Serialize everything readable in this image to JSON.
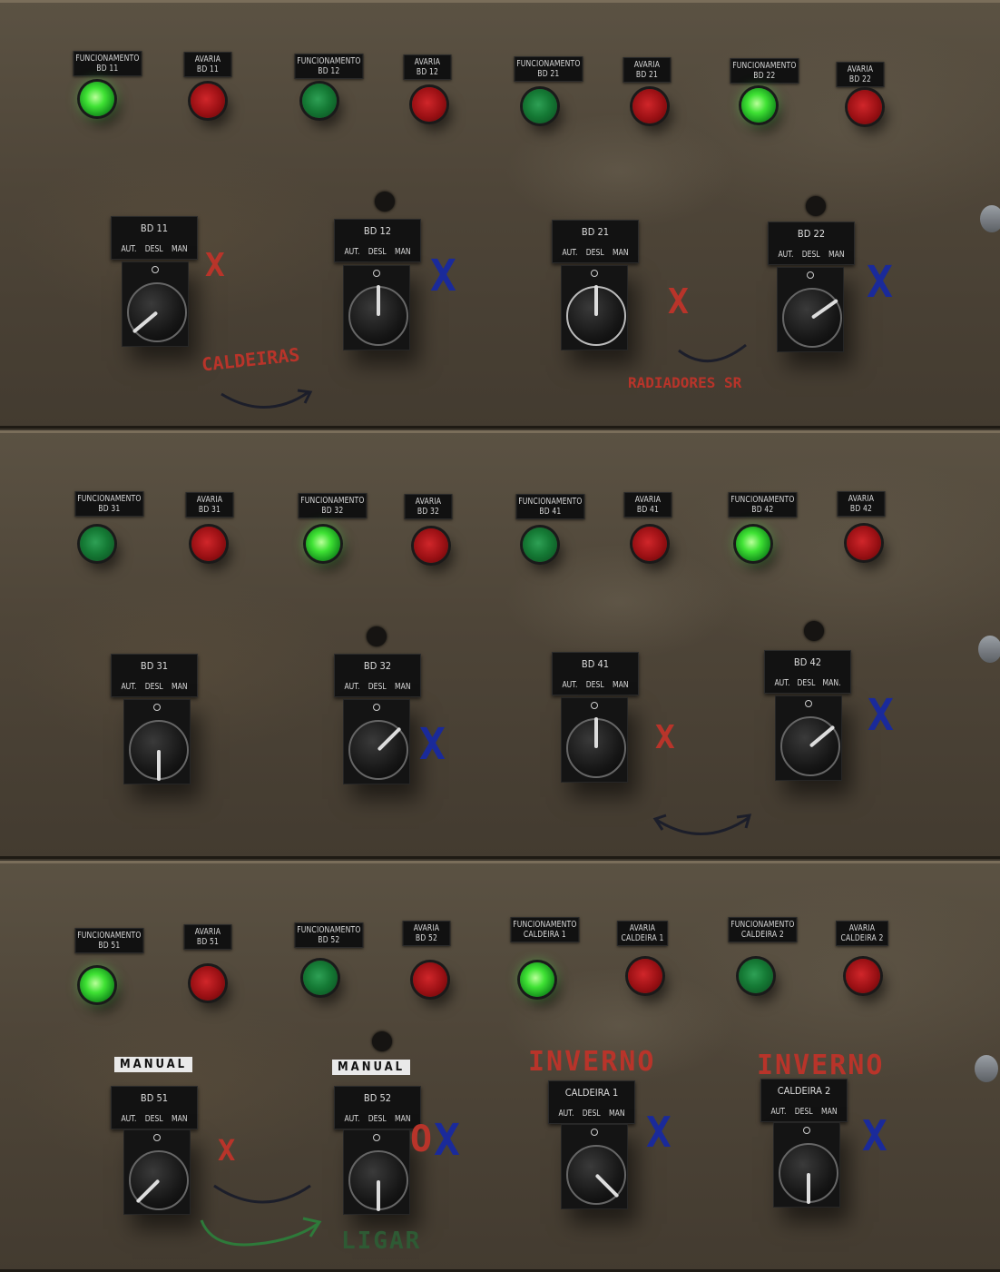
{
  "panels": [
    {
      "lamps": [
        {
          "l1": "FUNCIONAMENTO",
          "l2": "BD 11",
          "state": "g-on"
        },
        {
          "l1": "AVARIA",
          "l2": "BD 11",
          "state": "r-off"
        },
        {
          "l1": "FUNCIONAMENTO",
          "l2": "BD 12",
          "state": "g-off"
        },
        {
          "l1": "AVARIA",
          "l2": "BD 12",
          "state": "r-off"
        },
        {
          "l1": "FUNCIONAMENTO",
          "l2": "BD 21",
          "state": "g-off"
        },
        {
          "l1": "AVARIA",
          "l2": "BD 21",
          "state": "r-off"
        },
        {
          "l1": "FUNCIONAMENTO",
          "l2": "BD 22",
          "state": "g-on"
        },
        {
          "l1": "AVARIA",
          "l2": "BD 22",
          "state": "r-off"
        }
      ],
      "switches": [
        {
          "title": "BD 11",
          "aut": "AUT.",
          "desl": "DESL",
          "man": "MAN"
        },
        {
          "title": "BD 12",
          "aut": "AUT.",
          "desl": "DESL",
          "man": "MAN"
        },
        {
          "title": "BD 21",
          "aut": "AUT.",
          "desl": "DESL",
          "man": "MAN"
        },
        {
          "title": "BD 22",
          "aut": "AUT.",
          "desl": "DESL",
          "man": "MAN"
        }
      ],
      "notes": {
        "left": "CALDEIRAS",
        "right": "RADIADORES SR"
      }
    },
    {
      "lamps": [
        {
          "l1": "FUNCIONAMENTO",
          "l2": "BD 31",
          "state": "g-off"
        },
        {
          "l1": "AVARIA",
          "l2": "BD 31",
          "state": "r-off"
        },
        {
          "l1": "FUNCIONAMENTO",
          "l2": "BD 32",
          "state": "g-on"
        },
        {
          "l1": "AVARIA",
          "l2": "BD 32",
          "state": "r-off"
        },
        {
          "l1": "FUNCIONAMENTO",
          "l2": "BD 41",
          "state": "g-off"
        },
        {
          "l1": "AVARIA",
          "l2": "BD 41",
          "state": "r-off"
        },
        {
          "l1": "FUNCIONAMENTO",
          "l2": "BD 42",
          "state": "g-on"
        },
        {
          "l1": "AVARIA",
          "l2": "BD 42",
          "state": "r-off"
        }
      ],
      "switches": [
        {
          "title": "BD 31",
          "aut": "AUT.",
          "desl": "DESL",
          "man": "MAN"
        },
        {
          "title": "BD 32",
          "aut": "AUT.",
          "desl": "DESL",
          "man": "MAN"
        },
        {
          "title": "BD 41",
          "aut": "AUT.",
          "desl": "DESL",
          "man": "MAN"
        },
        {
          "title": "BD 42",
          "aut": "AUT.",
          "desl": "DESL",
          "man": "MAN."
        }
      ]
    },
    {
      "lamps": [
        {
          "l1": "FUNCIONAMENTO",
          "l2": "BD 51",
          "state": "g-on"
        },
        {
          "l1": "AVARIA",
          "l2": "BD 51",
          "state": "r-off"
        },
        {
          "l1": "FUNCIONAMENTO",
          "l2": "BD 52",
          "state": "g-off"
        },
        {
          "l1": "AVARIA",
          "l2": "BD 52",
          "state": "r-off"
        },
        {
          "l1": "FUNCIONAMENTO",
          "l2": "CALDEIRA 1",
          "state": "g-on"
        },
        {
          "l1": "AVARIA",
          "l2": "CALDEIRA 1",
          "state": "r-off"
        },
        {
          "l1": "FUNCIONAMENTO",
          "l2": "CALDEIRA 2",
          "state": "g-off"
        },
        {
          "l1": "AVARIA",
          "l2": "CALDEIRA 2",
          "state": "r-off"
        }
      ],
      "switches": [
        {
          "title": "BD 51",
          "aut": "AUT.",
          "desl": "DESL",
          "man": "MAN"
        },
        {
          "title": "BD 52",
          "aut": "AUT.",
          "desl": "DESL",
          "man": "MAN"
        },
        {
          "title": "CALDEIRA 1",
          "aut": "AUT.",
          "desl": "DESL",
          "man": "MAN"
        },
        {
          "title": "CALDEIRA 2",
          "aut": "AUT.",
          "desl": "DESL",
          "man": "MAN"
        }
      ],
      "manual_tags": [
        "MANUAL",
        "MANUAL"
      ],
      "notes": {
        "inverno1": "INVERNO",
        "inverno2": "INVERNO",
        "ligar": "LIGAR"
      }
    }
  ],
  "marks": {
    "x": "X",
    "o": "O"
  }
}
